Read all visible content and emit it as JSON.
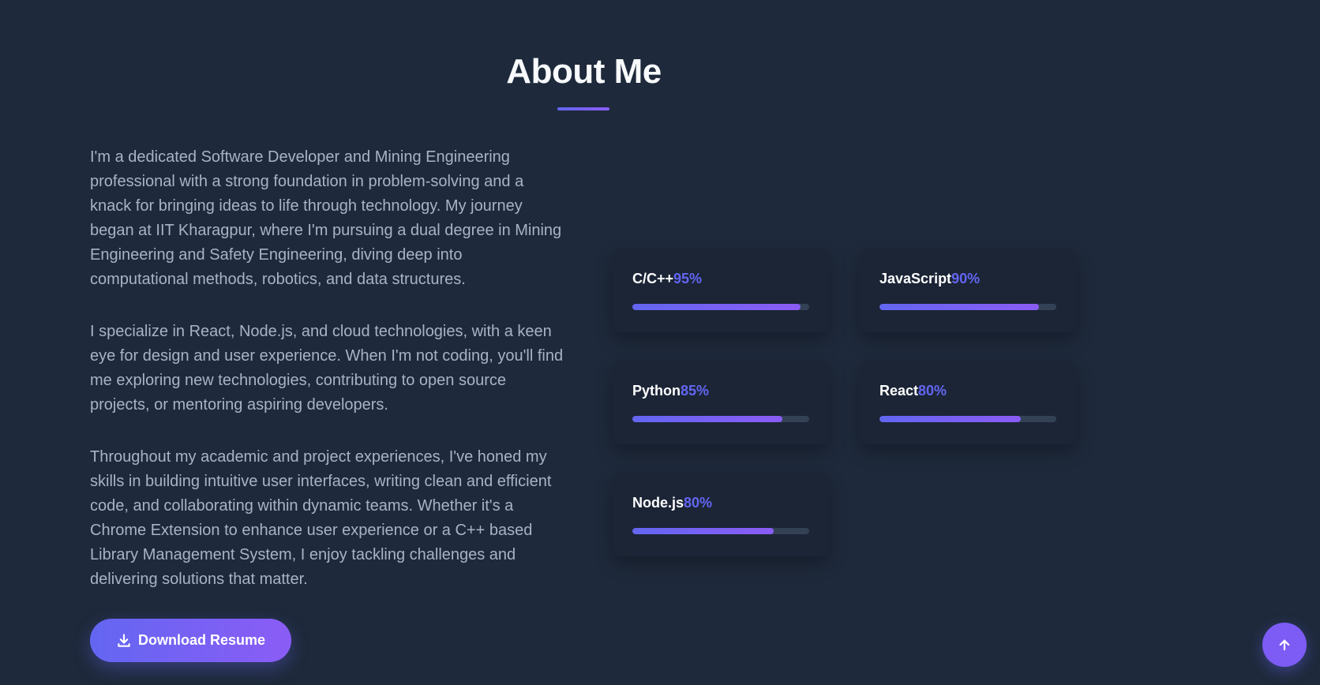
{
  "about": {
    "title": "About Me",
    "paragraphs": [
      "I'm a dedicated Software Developer and Mining Engineering professional with a strong foundation in problem-solving and a knack for bringing ideas to life through technology. My journey began at IIT Kharagpur, where I'm pursuing a dual degree in Mining Engineering and Safety Engineering, diving deep into computational methods, robotics, and data structures.",
      "I specialize in React, Node.js, and cloud technologies, with a keen eye for design and user experience. When I'm not coding, you'll find me exploring new technologies, contributing to open source projects, or mentoring aspiring developers.",
      "Throughout my academic and project experiences, I've honed my skills in building intuitive user interfaces, writing clean and efficient code, and collaborating within dynamic teams. Whether it's a Chrome Extension to enhance user experience or a C++ based Library Management System, I enjoy tackling challenges and delivering solutions that matter."
    ],
    "download_button": {
      "label": "Download Resume",
      "icon": "download-icon"
    }
  },
  "skills": [
    {
      "name": "C/C++",
      "percent_label": "95%",
      "level": 95
    },
    {
      "name": "JavaScript",
      "percent_label": "90%",
      "level": 90
    },
    {
      "name": "Python",
      "percent_label": "85%",
      "level": 85
    },
    {
      "name": "React",
      "percent_label": "80%",
      "level": 80
    },
    {
      "name": "Node.js",
      "percent_label": "80%",
      "level": 80
    }
  ],
  "scroll_top": {
    "icon": "arrow-up-icon"
  },
  "colors": {
    "background": "#1e293b",
    "accent": "#6366f1",
    "accent_secondary": "#8b5cf6",
    "card": "#1b2536",
    "text_muted": "#a8b3c6"
  }
}
